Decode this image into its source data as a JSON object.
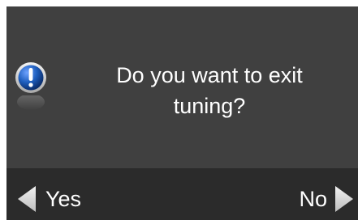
{
  "dialog": {
    "message": "Do you want to exit tuning?",
    "icon": "info-exclamation-icon"
  },
  "buttons": {
    "yes_label": "Yes",
    "no_label": "No",
    "yes_icon": "left-arrow-icon",
    "no_icon": "right-arrow-icon"
  },
  "colors": {
    "panel": "#404040",
    "button_bar": "#2b2b2b",
    "text": "#ffffff",
    "icon_blue": "#1f5fbf",
    "arrow": "#d8d8d8"
  }
}
